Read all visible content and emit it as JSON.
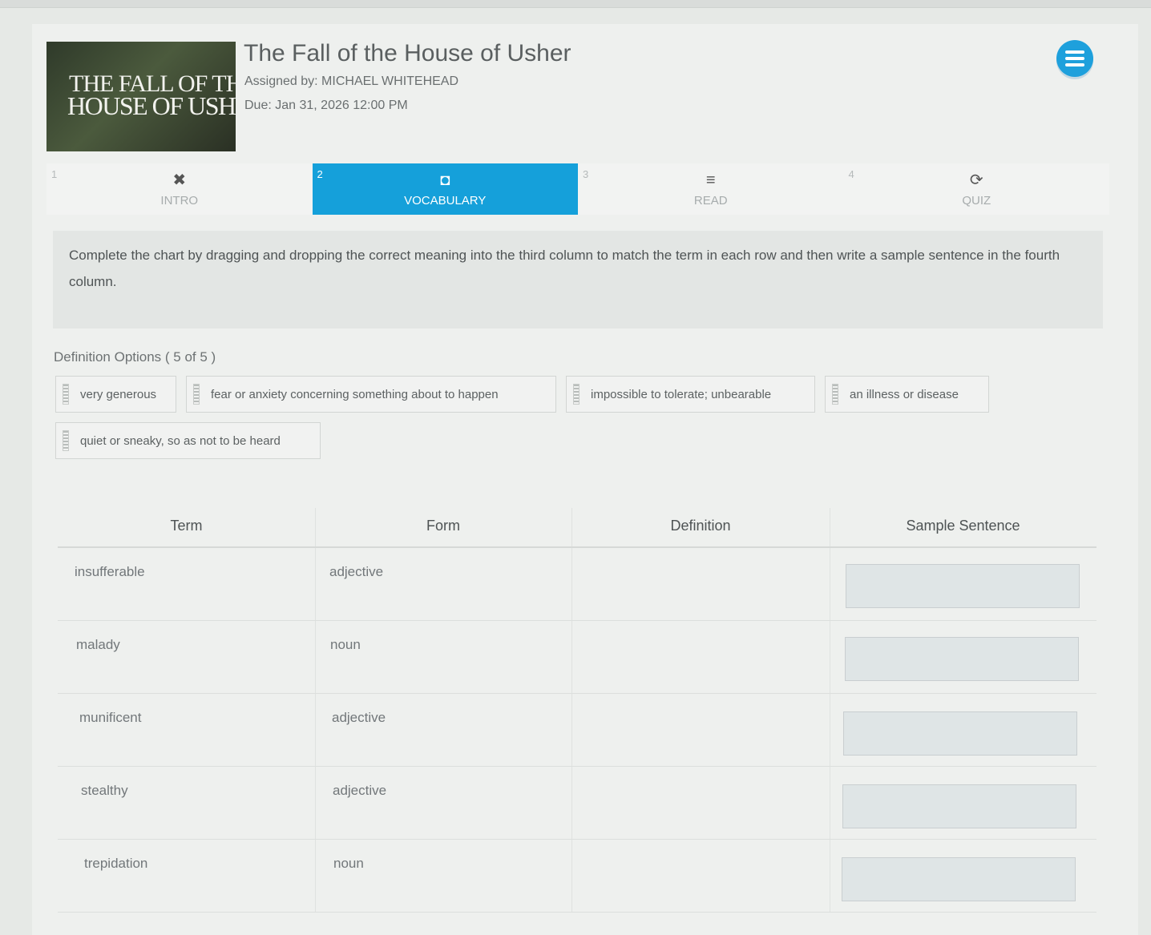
{
  "assignment": {
    "cover_line1": "THE FALL OF THE",
    "cover_line2": "HOUSE OF USHER",
    "title": "The Fall of the House of Usher",
    "assigned_by": "Assigned by: MICHAEL WHITEHEAD",
    "due": "Due: Jan 31, 2026 12:00 PM"
  },
  "menu": {
    "icon": "hamburger-icon"
  },
  "tabs": [
    {
      "num": "1",
      "label": "INTRO",
      "icon": "intro-icon",
      "glyph": "✖"
    },
    {
      "num": "2",
      "label": "VOCABULARY",
      "icon": "camera-icon",
      "glyph": "◘"
    },
    {
      "num": "3",
      "label": "READ",
      "icon": "lines-icon",
      "glyph": "≡"
    },
    {
      "num": "4",
      "label": "QUIZ",
      "icon": "refresh-icon",
      "glyph": "⟳"
    }
  ],
  "active_tab": 1,
  "instructions": "Complete the chart by dragging and dropping the correct meaning into the third column to match the term in each row and then write a sample sentence in the fourth column.",
  "definition_options": {
    "label": "Definition Options ( 5 of 5 )",
    "options": [
      "very generous",
      "fear or anxiety concerning something about to happen",
      "impossible to tolerate; unbearable",
      "an illness or disease",
      "quiet or sneaky, so as not to be heard"
    ]
  },
  "table": {
    "headers": [
      "Term",
      "Form",
      "Definition",
      "Sample Sentence"
    ],
    "rows": [
      {
        "term": "insufferable",
        "form": "adjective"
      },
      {
        "term": "malady",
        "form": "noun"
      },
      {
        "term": "munificent",
        "form": "adjective"
      },
      {
        "term": "stealthy",
        "form": "adjective"
      },
      {
        "term": "trepidation",
        "form": "noun"
      }
    ]
  }
}
